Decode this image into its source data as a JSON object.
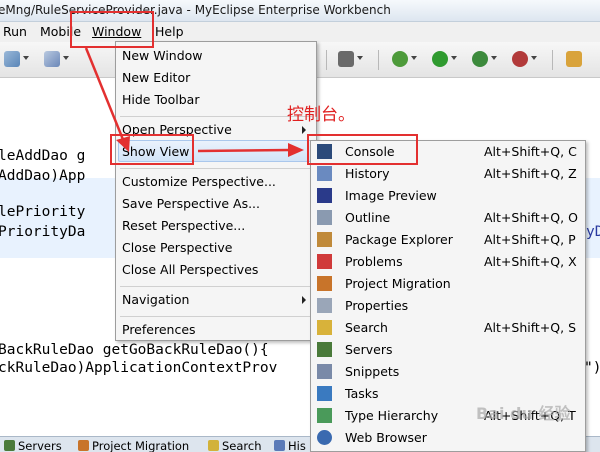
{
  "window": {
    "title": "eMng/RuleServiceProvider.java - MyEclipse Enterprise Workbench"
  },
  "menubar": {
    "items": [
      "Run",
      "Mobile",
      "Window",
      "Help"
    ]
  },
  "editor": {
    "lines": [
      "leAddDao g",
      "AddDao)App",
      "lePriority",
      "PriorityDa",
      "BackRuleDao getGoBackRuleDao(){",
      "ckRuleDao)ApplicationContextProv"
    ],
    "right_fragments": [
      "yD",
      "\")"
    ]
  },
  "window_menu": {
    "items": [
      {
        "label": "New Window"
      },
      {
        "label": "New Editor"
      },
      {
        "label": "Hide Toolbar"
      },
      {
        "label": "Open Perspective"
      },
      {
        "label": "Show View"
      },
      {
        "label": "Customize Perspective..."
      },
      {
        "label": "Save Perspective As..."
      },
      {
        "label": "Reset Perspective..."
      },
      {
        "label": "Close Perspective"
      },
      {
        "label": "Close All Perspectives"
      },
      {
        "label": "Navigation"
      },
      {
        "label": "Preferences"
      }
    ]
  },
  "show_view_menu": {
    "items": [
      {
        "label": "Console",
        "shortcut": "Alt+Shift+Q, C",
        "icon": "console-icon"
      },
      {
        "label": "History",
        "shortcut": "Alt+Shift+Q, Z",
        "icon": "history-icon"
      },
      {
        "label": "Image Preview",
        "shortcut": "",
        "icon": "image-preview-icon"
      },
      {
        "label": "Outline",
        "shortcut": "Alt+Shift+Q, O",
        "icon": "outline-icon"
      },
      {
        "label": "Package Explorer",
        "shortcut": "Alt+Shift+Q, P",
        "icon": "package-explorer-icon"
      },
      {
        "label": "Problems",
        "shortcut": "Alt+Shift+Q, X",
        "icon": "problems-icon"
      },
      {
        "label": "Project Migration",
        "shortcut": "",
        "icon": "project-migration-icon"
      },
      {
        "label": "Properties",
        "shortcut": "",
        "icon": "properties-icon"
      },
      {
        "label": "Search",
        "shortcut": "Alt+Shift+Q, S",
        "icon": "search-icon"
      },
      {
        "label": "Servers",
        "shortcut": "",
        "icon": "servers-icon"
      },
      {
        "label": "Snippets",
        "shortcut": "",
        "icon": "snippets-icon"
      },
      {
        "label": "Tasks",
        "shortcut": "",
        "icon": "tasks-icon"
      },
      {
        "label": "Type Hierarchy",
        "shortcut": "Alt+Shift+Q, T",
        "icon": "type-hierarchy-icon"
      },
      {
        "label": "Web Browser",
        "shortcut": "",
        "icon": "web-browser-icon"
      }
    ]
  },
  "annotation": {
    "text": "控制台。"
  },
  "bottom_tabs": [
    {
      "label": "Servers",
      "icon": "servers-icon"
    },
    {
      "label": "Project Migration",
      "icon": "project-migration-icon"
    },
    {
      "label": "Search",
      "icon": "search-icon"
    },
    {
      "label": "His",
      "icon": "history-icon"
    }
  ],
  "watermark": {
    "text": "Bai du 经验"
  },
  "colors": {
    "annotation_red": "#e33030",
    "highlight_blue": "#d2e4f8",
    "editor_line_highlight": "#e8f2fe"
  }
}
